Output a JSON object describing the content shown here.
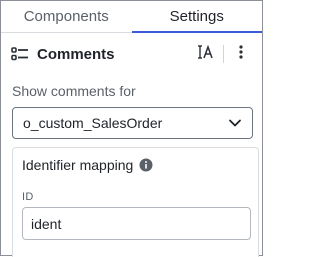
{
  "tabs": [
    {
      "label": "Components",
      "active": false
    },
    {
      "label": "Settings",
      "active": true
    }
  ],
  "header": {
    "icon": "list-comments-icon",
    "title": "Comments",
    "text_icon": "text-cursor-icon",
    "more_icon": "more-vertical-icon"
  },
  "show_comments": {
    "label": "Show comments for",
    "selected": "o_custom_SalesOrder",
    "chevron": "chevron-down-icon"
  },
  "identifier": {
    "title": "Identifier mapping",
    "info_icon": "info-icon",
    "field_label": "ID",
    "field_value": "ident"
  },
  "colors": {
    "accent": "#3b5bdb",
    "text": "#1f2329",
    "muted": "#5b6069"
  }
}
